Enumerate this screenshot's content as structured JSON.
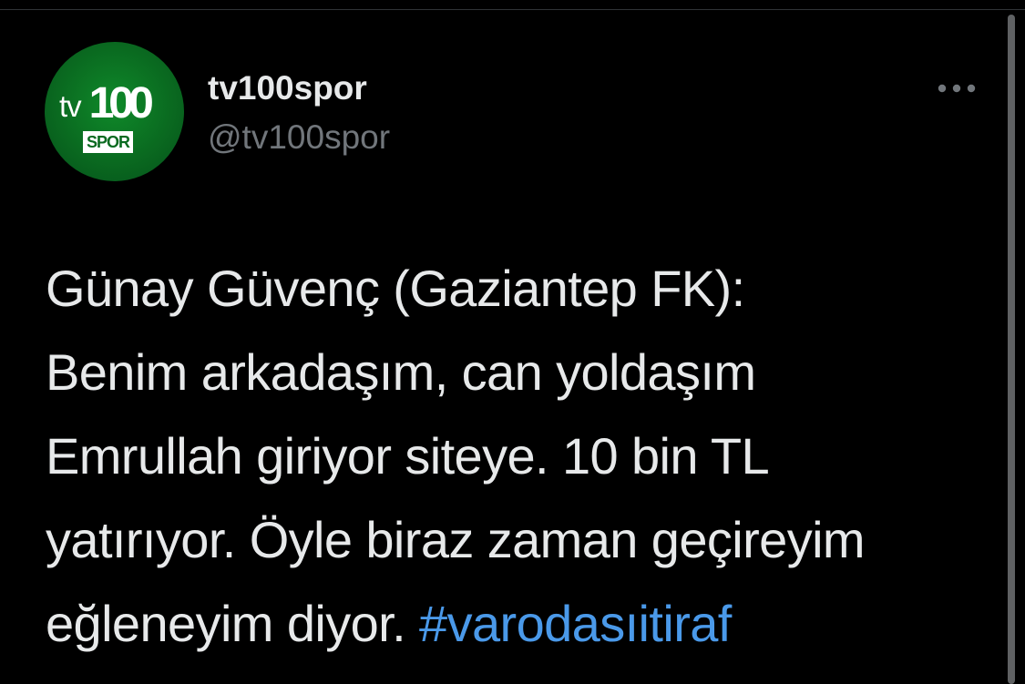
{
  "user": {
    "display_name": "tv100spor",
    "handle": "@tv100spor",
    "avatar_logo": {
      "tv": "tv",
      "number": "100",
      "badge": "SPOR"
    }
  },
  "more_icon": "more-horizontal-icon",
  "tweet": {
    "body": "Günay Güvenç (Gaziantep FK):\nBenim arkadaşım, can yoldaşım\nEmrullah giriyor siteye. 10 bin TL\nyatırıyor. Öyle biraz zaman geçireyim\neğleneyim diyor. ",
    "hashtag": "#varodasıitiraf"
  },
  "colors": {
    "background": "#000000",
    "text": "#e7e9ea",
    "secondary_text": "#71767b",
    "link": "#4a99e9",
    "avatar_green": "#0a6a20"
  }
}
